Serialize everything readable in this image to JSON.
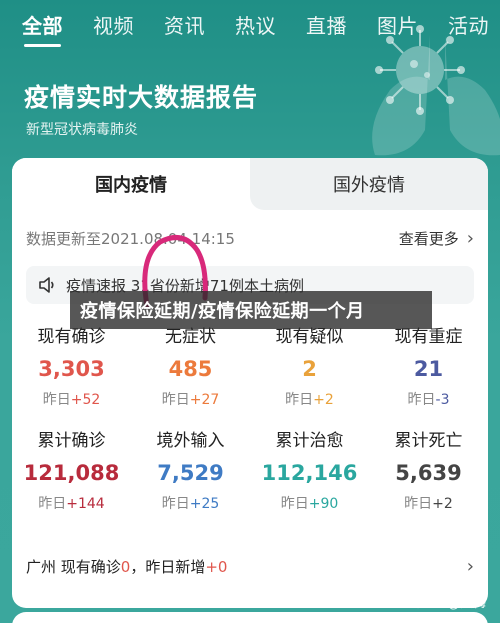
{
  "nav": {
    "tabs": [
      {
        "label": "全部"
      },
      {
        "label": "视频"
      },
      {
        "label": "资讯"
      },
      {
        "label": "热议"
      },
      {
        "label": "直播"
      },
      {
        "label": "图片"
      },
      {
        "label": "活动"
      }
    ]
  },
  "banner": {
    "title": "疫情实时大数据报告",
    "subtitle": "新型冠状病毒肺炎"
  },
  "card": {
    "tabs": [
      {
        "label": "国内疫情"
      },
      {
        "label": "国外疫情"
      }
    ],
    "update_text": "数据更新至2021.08.04 14:15",
    "more_label": "查看更多",
    "alert_text": "疫情速报  31省份新增71例本土病例",
    "stats_row1": [
      {
        "label": "现有确诊",
        "value": "3,303",
        "delta_prefix": "昨日",
        "delta": "+52",
        "color": "#e0564c"
      },
      {
        "label": "无症状",
        "value": "485",
        "delta_prefix": "昨日",
        "delta": "+27",
        "color": "#ec7a3c"
      },
      {
        "label": "现有疑似",
        "value": "2",
        "delta_prefix": "昨日",
        "delta": "+2",
        "color": "#e9a23b"
      },
      {
        "label": "现有重症",
        "value": "21",
        "delta_prefix": "昨日",
        "delta": "-3",
        "color": "#4c5aa0"
      }
    ],
    "stats_row2": [
      {
        "label": "累计确诊",
        "value": "121,088",
        "delta_prefix": "昨日",
        "delta": "+144",
        "color": "#b82b3c"
      },
      {
        "label": "境外输入",
        "value": "7,529",
        "delta_prefix": "昨日",
        "delta": "+25",
        "color": "#3f7bc4"
      },
      {
        "label": "累计治愈",
        "value": "112,146",
        "delta_prefix": "昨日",
        "delta": "+90",
        "color": "#2aa79f"
      },
      {
        "label": "累计死亡",
        "value": "5,639",
        "delta_prefix": "昨日",
        "delta": "+2",
        "color": "#444444"
      }
    ],
    "region": {
      "prefix": "广州 现有确诊",
      "current": "0",
      "middle": "，昨日新增",
      "new": "+0"
    }
  },
  "caption": "疫情保险延期/疫情保险延期一个月",
  "watermark": "知乎 @天梅"
}
